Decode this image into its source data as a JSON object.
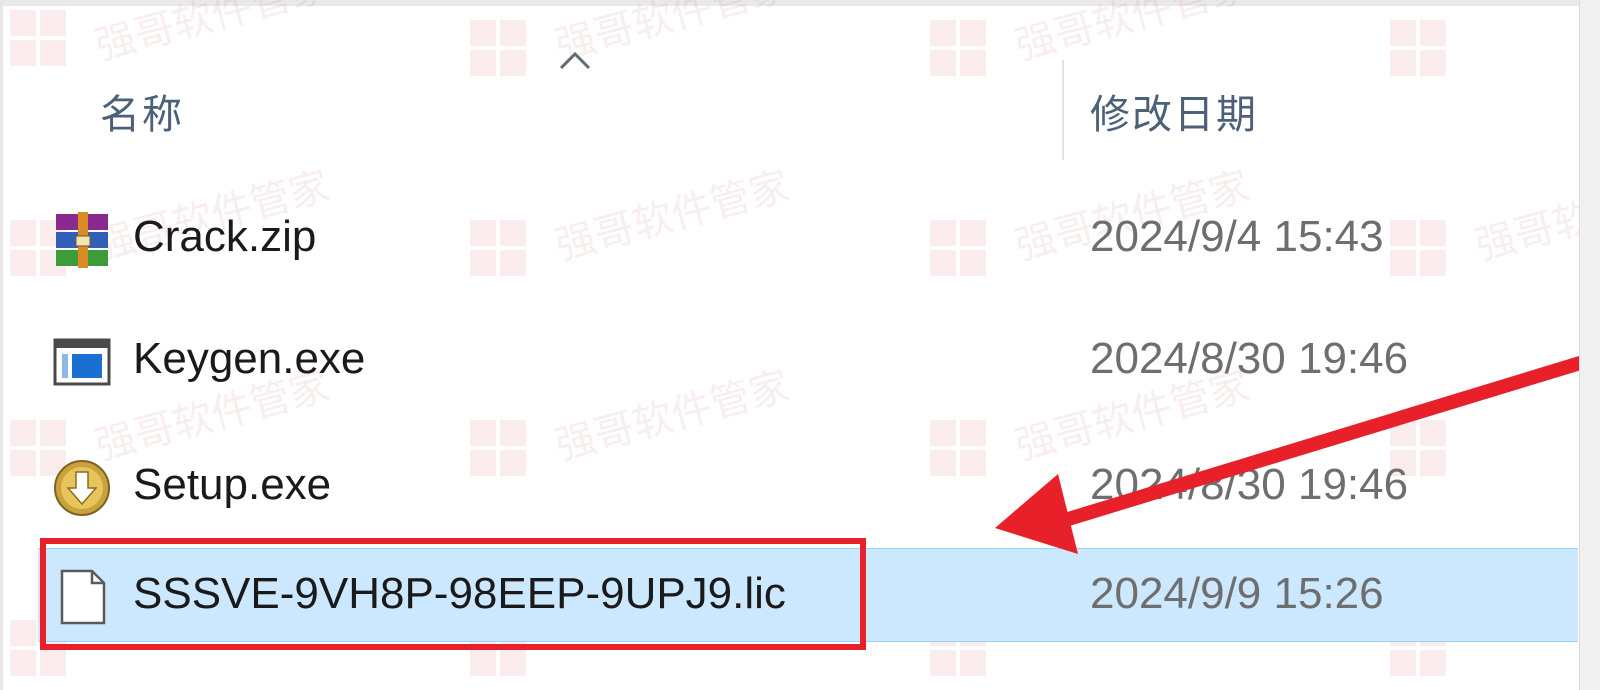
{
  "columns": {
    "name_label": "名称",
    "date_label": "修改日期",
    "sort_direction": "ascending"
  },
  "files": [
    {
      "name": "Crack.zip",
      "modified": "2024/9/4 15:43",
      "icon": "winrar-archive-icon",
      "selected": false
    },
    {
      "name": "Keygen.exe",
      "modified": "2024/8/30 19:46",
      "icon": "application-window-icon",
      "selected": false
    },
    {
      "name": "Setup.exe",
      "modified": "2024/8/30 19:46",
      "icon": "setup-installer-icon",
      "selected": false
    },
    {
      "name": "SSSVE-9VH8P-98EEP-9UPJ9.lic",
      "modified": "2024/9/9 15:26",
      "icon": "blank-document-icon",
      "selected": true
    }
  ],
  "watermark_text": "强哥软件管家",
  "annotation": {
    "highlight_color": "#e8202a",
    "selection_color": "#cce8ff"
  }
}
